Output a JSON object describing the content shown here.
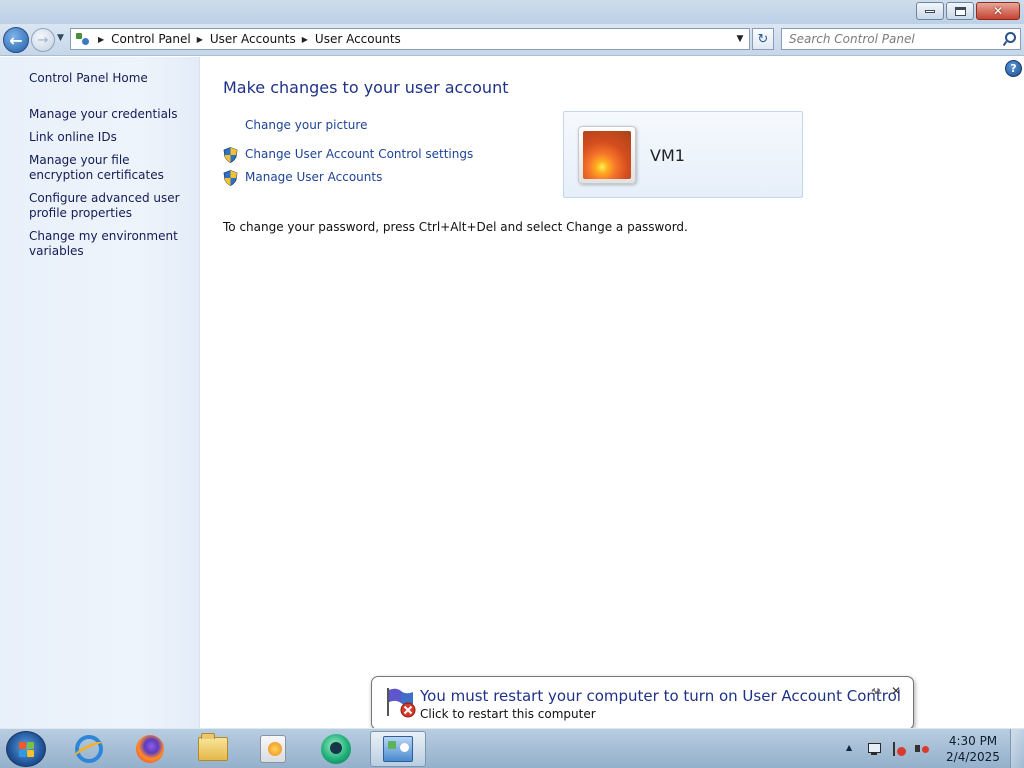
{
  "window": {
    "minimize_label": "",
    "close_glyph": "✕"
  },
  "nav": {
    "breadcrumbs": [
      "Control Panel",
      "User Accounts",
      "User Accounts"
    ],
    "search_placeholder": "Search Control Panel"
  },
  "sidebar": {
    "home": "Control Panel Home",
    "links": [
      "Manage your credentials",
      "Link online IDs",
      "Manage your file encryption certificates",
      "Configure advanced user profile properties",
      "Change my environment variables"
    ]
  },
  "main": {
    "heading": "Make changes to your user account",
    "tasks": [
      "Change your picture",
      "Change User Account Control settings",
      "Manage User Accounts"
    ],
    "account_name": "VM1",
    "password_note": "To change your password, press Ctrl+Alt+Del and select Change a password.",
    "help_glyph": "?"
  },
  "notification": {
    "title": "You must restart your computer to turn on User Account Control",
    "subtitle": "Click to restart this computer",
    "close_glyph": "✕"
  },
  "taskbar": {
    "pinned": [
      "internet-explorer",
      "firefox",
      "windows-explorer",
      "media-player",
      "app",
      "control-panel"
    ],
    "clock_time": "4:30 PM",
    "clock_date": "2/4/2025"
  },
  "colors": {
    "link": "#1e4396",
    "heading": "#1e3287",
    "sidebar_bg": "#e8f0fa"
  }
}
